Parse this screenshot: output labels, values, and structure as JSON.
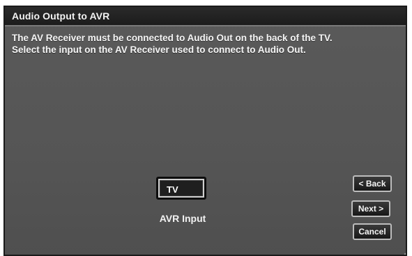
{
  "window": {
    "title": "Audio Output to AVR"
  },
  "instructions": {
    "line1": "The AV Receiver must be connected to Audio Out on the back of the TV.",
    "line2": "Select the input on the AV Receiver used to connect to Audio Out."
  },
  "avr_input": {
    "value": "TV",
    "label": "AVR Input"
  },
  "buttons": {
    "back": "< Back",
    "next": "Next >",
    "cancel": "Cancel"
  },
  "corner_icon": "©"
}
